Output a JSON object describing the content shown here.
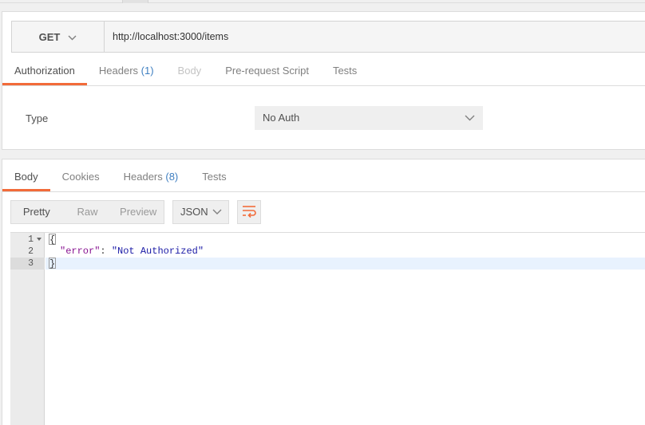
{
  "request": {
    "method": "GET",
    "url": "http://localhost:3000/items",
    "tabs": [
      {
        "label": "Authorization"
      },
      {
        "label": "Headers",
        "count": "(1)"
      },
      {
        "label": "Body"
      },
      {
        "label": "Pre-request Script"
      },
      {
        "label": "Tests"
      }
    ],
    "auth": {
      "type_label": "Type",
      "type_value": "No Auth"
    }
  },
  "response": {
    "tabs": [
      {
        "label": "Body"
      },
      {
        "label": "Cookies"
      },
      {
        "label": "Headers",
        "count": "(8)"
      },
      {
        "label": "Tests"
      }
    ],
    "view_modes": [
      "Pretty",
      "Raw",
      "Preview"
    ],
    "format": "JSON",
    "editor": {
      "line_numbers": [
        "1",
        "2",
        "3"
      ],
      "lines": {
        "open": "{",
        "key": "\"error\"",
        "colon": ": ",
        "value": "\"Not Authorized\"",
        "close": "}"
      }
    }
  },
  "colors": {
    "accent": "#f26b3a",
    "count": "#3f7fc1",
    "json_key": "#881391",
    "json_string": "#1a1aa6"
  },
  "icons": {
    "method_dropdown": "chevron-down-icon",
    "auth_dropdown": "chevron-down-icon",
    "format_dropdown": "chevron-down-icon",
    "wrap": "wrap-lines-icon",
    "fold": "fold-arrow-icon"
  }
}
